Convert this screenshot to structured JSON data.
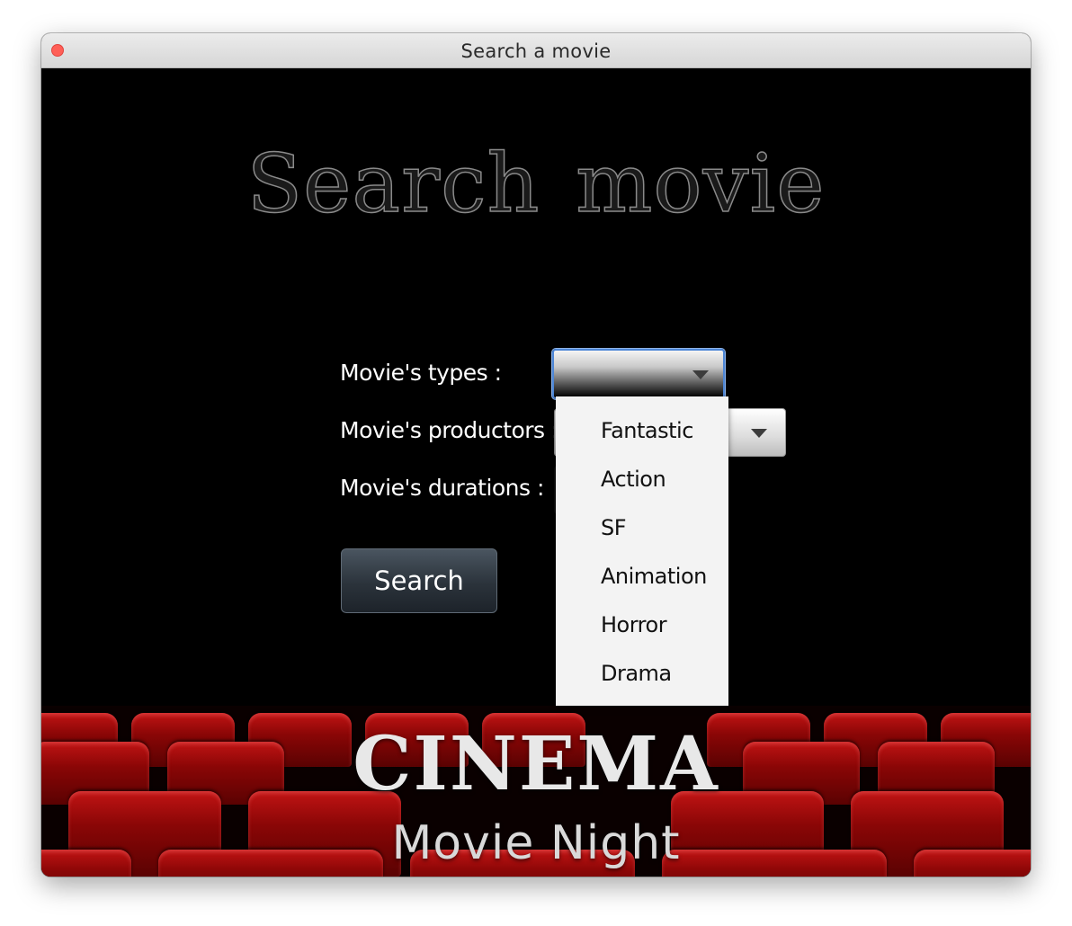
{
  "window": {
    "title": "Search a movie"
  },
  "main": {
    "heading": "Search movie",
    "labels": {
      "types": "Movie's types :",
      "productors": "Movie's productors :",
      "durations": "Movie's durations :"
    },
    "types_combo": {
      "value": ""
    },
    "productors_combo": {
      "value": ""
    },
    "durations_combo": {
      "value": ""
    },
    "search_button": "Search"
  },
  "dropdown": {
    "options": [
      "Fantastic",
      "Action",
      "SF",
      "Animation",
      "Horror",
      "Drama"
    ]
  },
  "banner": {
    "cinema": "CINEMA",
    "subtitle": "Movie Night"
  },
  "colors": {
    "background": "#000000",
    "seat_red": "#a00a0a",
    "close_button": "#ff5f57",
    "focus_ring": "#4d86d6"
  },
  "icons": {
    "dropdown_arrow": "chevron-down-icon",
    "close": "close-icon"
  }
}
